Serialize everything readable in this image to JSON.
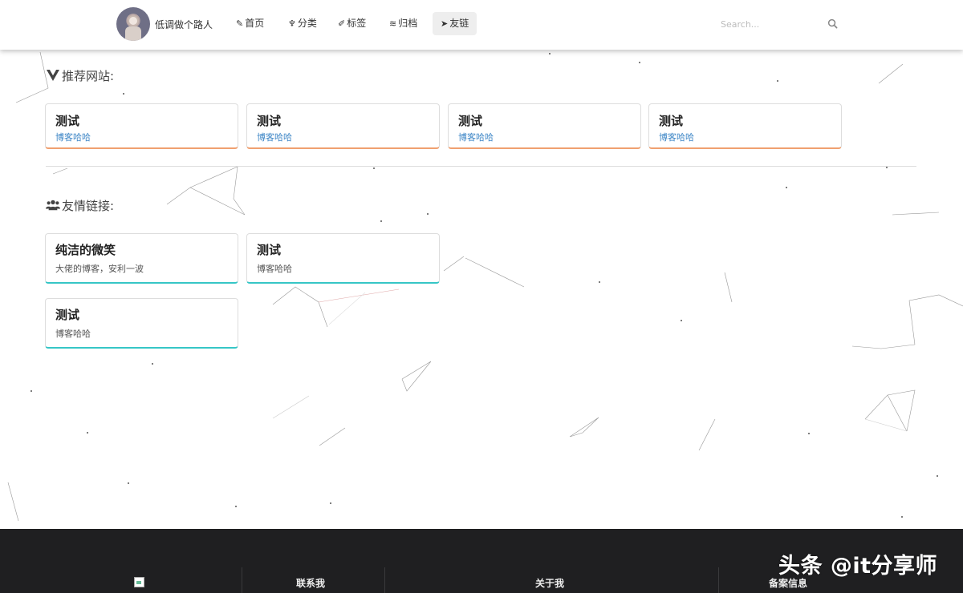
{
  "header": {
    "site_name": "低调做个路人",
    "nav": [
      {
        "label": "首页",
        "icon": "pencil-icon"
      },
      {
        "label": "分类",
        "icon": "icecream-icon"
      },
      {
        "label": "标签",
        "icon": "brush-icon"
      },
      {
        "label": "归档",
        "icon": "rss-icon"
      },
      {
        "label": "友链",
        "icon": "fish-icon",
        "active": true
      }
    ],
    "search": {
      "placeholder": "Search..."
    }
  },
  "recommend": {
    "title": "推荐网站:",
    "cards": [
      {
        "title": "测试",
        "desc": "博客哈哈"
      },
      {
        "title": "测试",
        "desc": "博客哈哈"
      },
      {
        "title": "测试",
        "desc": "博客哈哈"
      },
      {
        "title": "测试",
        "desc": "博客哈哈"
      }
    ]
  },
  "friends": {
    "title": "友情链接:",
    "cards": [
      {
        "title": "纯洁的微笑",
        "desc": "大佬的博客，安利一波"
      },
      {
        "title": "测试",
        "desc": "博客哈哈"
      },
      {
        "title": "测试",
        "desc": "博客哈哈"
      }
    ]
  },
  "footer": {
    "columns": [
      "联系我",
      "关于我",
      "备案信息"
    ],
    "watermark": "头条 @it分享师"
  },
  "colors": {
    "recommend_accent": "#f0a070",
    "friend_accent": "#36c6c6",
    "link_blue": "#3d86c6",
    "footer_bg": "#1f1f21"
  }
}
